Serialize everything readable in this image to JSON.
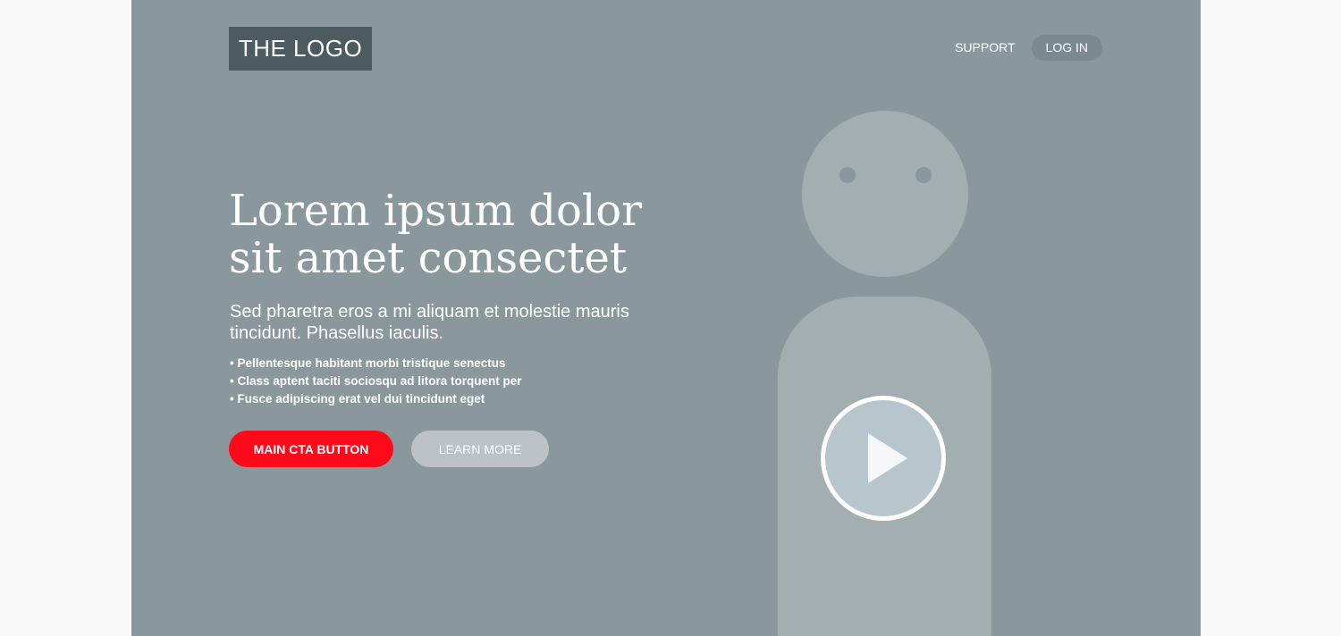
{
  "header": {
    "logo_text": "THE LOGO",
    "nav": {
      "support_label": "SUPPORT",
      "login_label": "LOG IN"
    }
  },
  "hero": {
    "headline_line1": "Lorem ipsum dolor",
    "headline_line2": "sit amet consectet",
    "subtitle": "Sed pharetra eros a mi aliquam et molestie mauris tincidunt. Phasellus iaculis.",
    "bullets": [
      "Pellentesque habitant morbi tristique senectus",
      "Class aptent taciti sociosqu ad litora torquent per",
      "Fusce adipiscing erat vel dui tincidunt eget"
    ],
    "cta_label": "MAIN CTA BUTTON",
    "learn_more_label": "LEARN MORE"
  },
  "media": {
    "illustration_icon": "person-placeholder-icon",
    "play_icon": "play-icon"
  },
  "colors": {
    "hero_background": "#8a989e",
    "logo_background": "#4d5b61",
    "cta": "#ff0a1a",
    "secondary_button": "#bcc2c5",
    "illustration": "#a3aeb0",
    "play_fill": "#b6c6cc"
  }
}
